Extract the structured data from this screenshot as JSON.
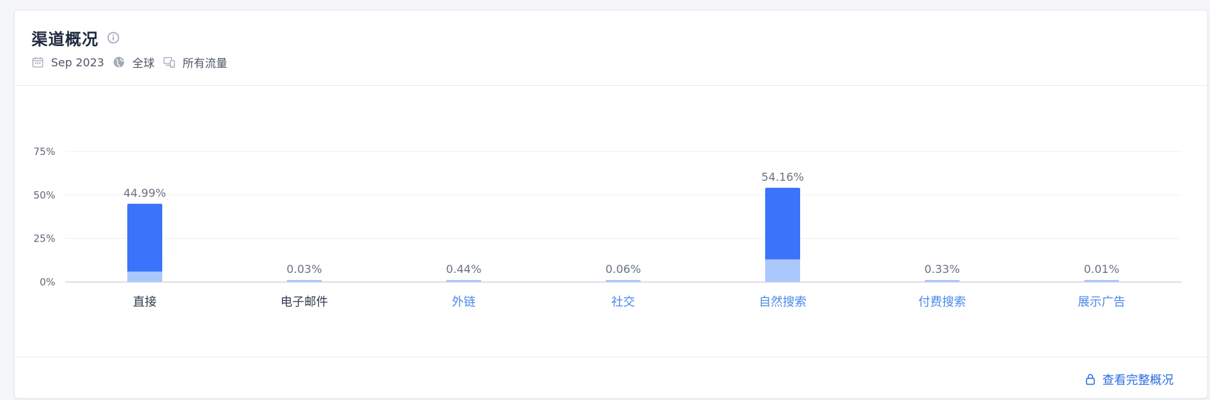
{
  "header": {
    "title": "渠道概况",
    "date": "Sep 2023",
    "region": "全球",
    "traffic": "所有流量"
  },
  "footer": {
    "full_overview_label": "查看完整概况"
  },
  "colors": {
    "bar_primary": "#3b74fb",
    "bar_secondary": "#abc8fd",
    "link": "#4a88ea",
    "label_dark": "#2f3a4c"
  },
  "chart_data": {
    "type": "bar",
    "title": "",
    "xlabel": "",
    "ylabel": "",
    "ylim": [
      0,
      75
    ],
    "yticks": [
      "75%",
      "50%",
      "25%",
      "0%"
    ],
    "ytick_values": [
      75,
      50,
      25,
      0
    ],
    "grid": true,
    "categories": [
      "直接",
      "电子邮件",
      "外链",
      "社交",
      "自然搜索",
      "付费搜索",
      "展示广告"
    ],
    "category_is_link": [
      false,
      false,
      true,
      true,
      true,
      true,
      true
    ],
    "values": [
      44.99,
      0.03,
      0.44,
      0.06,
      54.16,
      0.33,
      0.01
    ],
    "value_labels": [
      "44.99%",
      "0.03%",
      "0.44%",
      "0.06%",
      "54.16%",
      "0.33%",
      "0.01%"
    ],
    "secondary_values": [
      6.0,
      0.0,
      0.0,
      0.0,
      13.0,
      0.0,
      0.0
    ]
  }
}
